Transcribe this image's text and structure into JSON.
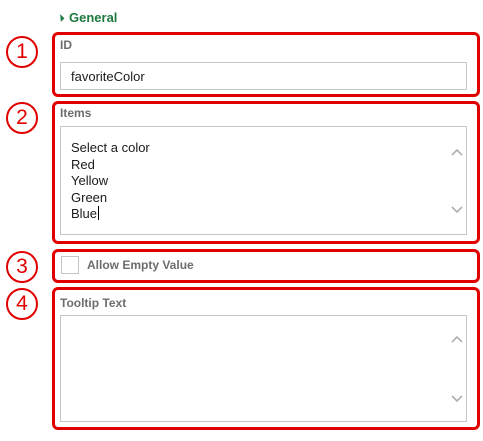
{
  "section": {
    "title": "General"
  },
  "callouts": [
    "1",
    "2",
    "3",
    "4"
  ],
  "id_field": {
    "label": "ID",
    "value": "favoriteColor"
  },
  "items_field": {
    "label": "Items",
    "lines": [
      "Select a color",
      "Red",
      "Yellow",
      "Green",
      "Blue"
    ]
  },
  "allow_empty": {
    "label": "Allow Empty Value",
    "checked": false
  },
  "tooltip_field": {
    "label": "Tooltip Text",
    "value": ""
  },
  "colors": {
    "callout_red": "#e00000",
    "section_green": "#1f7a3f",
    "label_gray": "#6d6d6d",
    "border_gray": "#c6c6c6"
  }
}
